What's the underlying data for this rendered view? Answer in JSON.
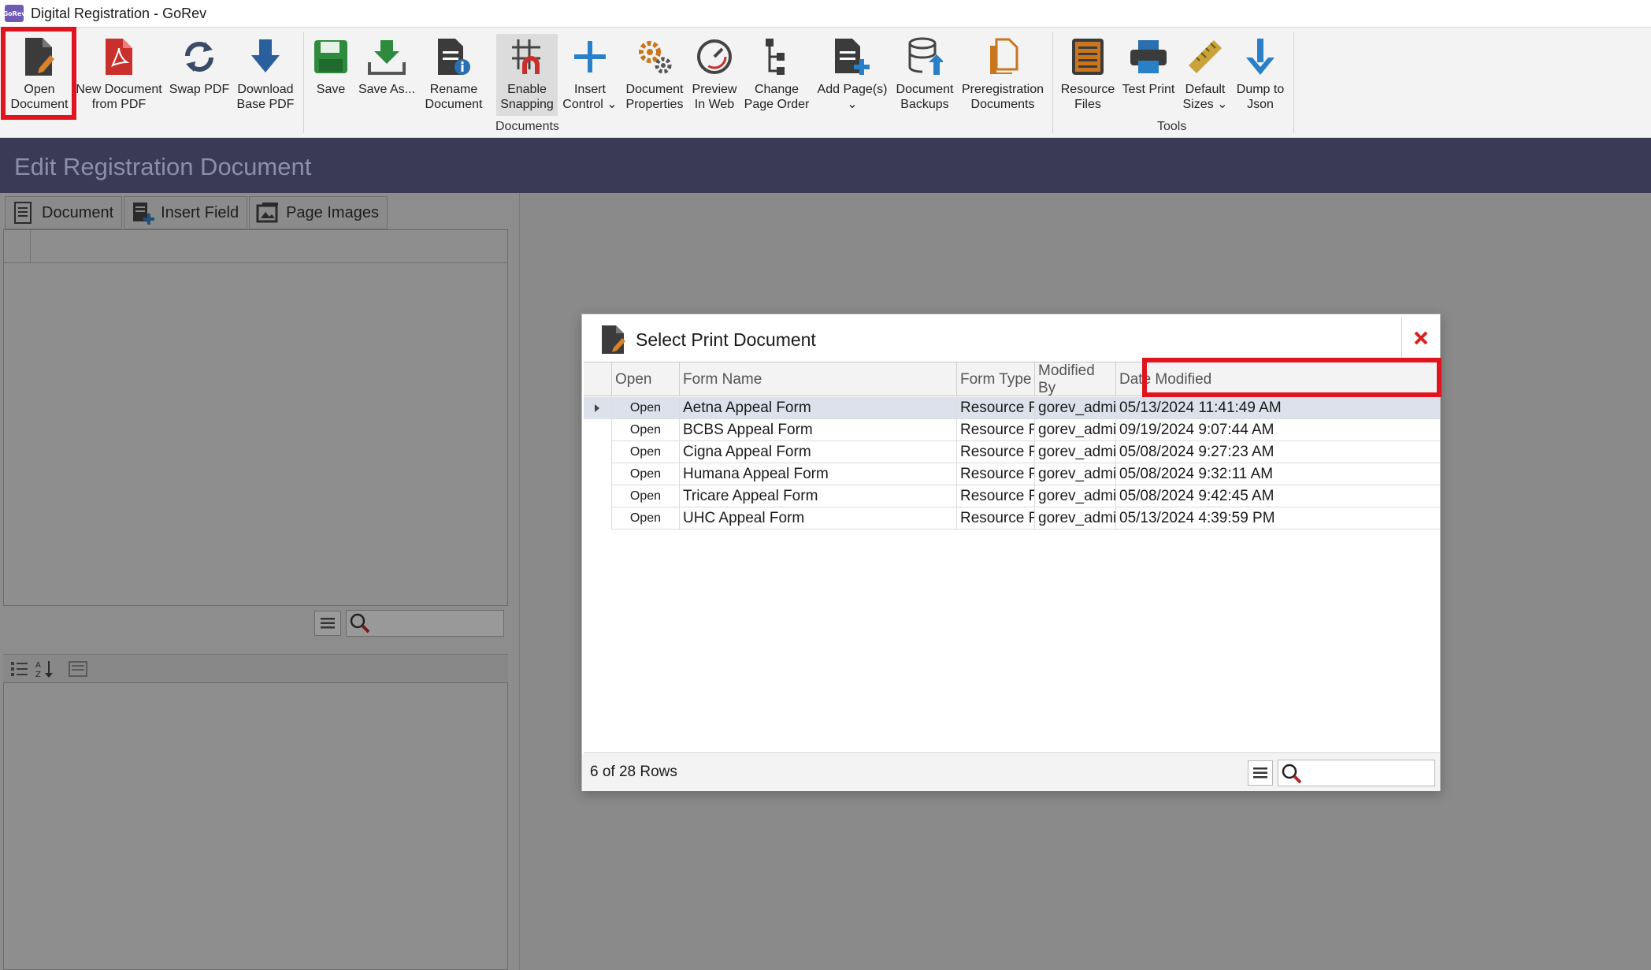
{
  "window": {
    "title": "Digital Registration - GoRev",
    "logo_text": "GoRev"
  },
  "ribbon": {
    "buttons": [
      {
        "label": "Open\nDocument",
        "icon": "open-document-icon"
      },
      {
        "label": "New Document\nfrom PDF",
        "icon": "pdf-icon"
      },
      {
        "label": "Swap PDF",
        "icon": "swap-icon"
      },
      {
        "label": "Download\nBase PDF",
        "icon": "download-icon"
      },
      {
        "label": "Save",
        "icon": "save-icon"
      },
      {
        "label": "Save As...",
        "icon": "save-as-icon"
      },
      {
        "label": "Rename\nDocument",
        "icon": "rename-icon"
      },
      {
        "label": "Enable\nSnapping",
        "icon": "snapping-icon"
      },
      {
        "label": "Insert\nControl ⌄",
        "icon": "plus-icon"
      },
      {
        "label": "Document\nProperties",
        "icon": "gears-icon"
      },
      {
        "label": "Preview\nIn Web",
        "icon": "gauge-icon"
      },
      {
        "label": "Change\nPage Order",
        "icon": "hierarchy-icon"
      },
      {
        "label": "Add Page(s)\n⌄",
        "icon": "add-page-icon"
      },
      {
        "label": "Document\nBackups",
        "icon": "database-icon"
      },
      {
        "label": "Preregistration\nDocuments",
        "icon": "copy-icon"
      },
      {
        "label": "Resource\nFiles",
        "icon": "list-icon"
      },
      {
        "label": "Test Print",
        "icon": "printer-icon"
      },
      {
        "label": "Default\nSizes ⌄",
        "icon": "ruler-icon"
      },
      {
        "label": "Dump to\nJson",
        "icon": "arrow-down-icon"
      }
    ],
    "groups": {
      "documents": "Documents",
      "tools": "Tools"
    }
  },
  "page": {
    "heading": "Edit Registration Document"
  },
  "left_panel": {
    "tabs": [
      {
        "label": "Document"
      },
      {
        "label": "Insert Field"
      },
      {
        "label": "Page Images"
      }
    ]
  },
  "dialog": {
    "title": "Select Print Document",
    "columns": [
      "Open",
      "Form Name",
      "Form Type",
      "Modified By",
      "Date Modified"
    ],
    "rows": [
      {
        "open": "Open",
        "name": "Aetna Appeal Form",
        "type": "Resource Files",
        "by": "gorev_admin",
        "date": "05/13/2024 11:41:49 AM"
      },
      {
        "open": "Open",
        "name": "BCBS Appeal Form",
        "type": "Resource Files",
        "by": "gorev_admin",
        "date": "09/19/2024 9:07:44 AM"
      },
      {
        "open": "Open",
        "name": "Cigna Appeal Form",
        "type": "Resource Files",
        "by": "gorev_admin",
        "date": "05/08/2024 9:27:23 AM"
      },
      {
        "open": "Open",
        "name": "Humana Appeal Form",
        "type": "Resource Files",
        "by": "gorev_admin",
        "date": "05/08/2024 9:32:11 AM"
      },
      {
        "open": "Open",
        "name": "Tricare Appeal Form",
        "type": "Resource Files",
        "by": "gorev_admin",
        "date": "05/08/2024 9:42:45 AM"
      },
      {
        "open": "Open",
        "name": "UHC Appeal Form",
        "type": "Resource Files",
        "by": "gorev_admin",
        "date": "05/13/2024 4:39:59 PM"
      }
    ],
    "row_count": "6 of 28 Rows"
  },
  "colors": {
    "highlight": "#e0141e",
    "header_band": "#3a3a55",
    "close": "#d9201e"
  }
}
